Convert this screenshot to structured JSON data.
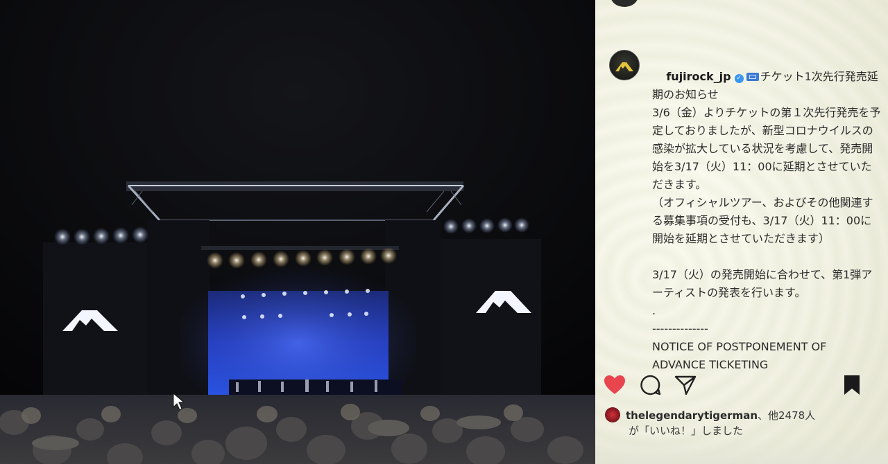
{
  "post": {
    "photo_alt": "Fuji Rock festival main stage at night",
    "header_username": "fujirock_jp",
    "verified": "✓",
    "caption_title": "チケット1次先行発売延期のお知らせ",
    "caption_body": "3/6（金）よりチケットの第１次先行発売を予定しておりましたが、新型コロナウイルスの感染が拡大している状況を考慮して、発売開始を3/17（火）11：00に延期とさせていただきます。\n（オフィシャルツアー、およびその他関連する募集事項の受付も、3/17（火）11：00に開始を延期とさせていただきます）\n\n3/17（火）の発売開始に合わせて、第1弾アーティストの発表を行います。\n.\n--------------\nNOTICE OF POSTPONEMENT OF ADVANCE TICKETING",
    "likes_user": "thelegendarytigerman",
    "likes_suffix": "、他2478人",
    "likes_line2": "が「いいね！」しました"
  },
  "icons": {
    "like": "heart-icon",
    "comment": "comment-icon",
    "share": "share-icon",
    "save": "bookmark-icon"
  },
  "colors": {
    "like_red": "#e8454f",
    "verified_blue": "#3897f0",
    "panel_bg": "#f4f3e6"
  }
}
